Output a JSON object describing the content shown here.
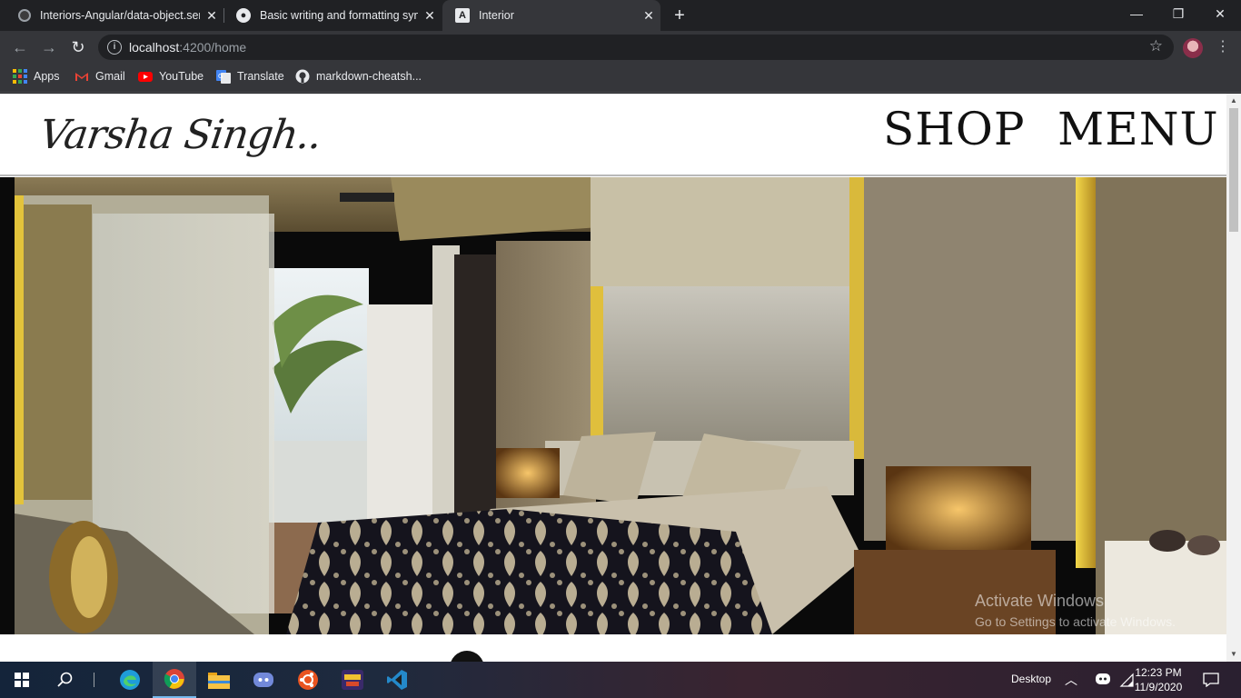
{
  "browser": {
    "tabs": [
      {
        "title": "Interiors-Angular/data-object.ser",
        "icon": "github-icon",
        "active": false
      },
      {
        "title": "Basic writing and formatting synt",
        "icon": "github-icon",
        "active": false
      },
      {
        "title": "Interior",
        "icon": "angular-icon",
        "active": true
      }
    ],
    "address": {
      "host": "localhost",
      "rest": ":4200/home"
    },
    "bookmarks": [
      {
        "label": "Apps",
        "icon": "apps-grid-icon"
      },
      {
        "label": "Gmail",
        "icon": "gmail-icon"
      },
      {
        "label": "YouTube",
        "icon": "youtube-icon"
      },
      {
        "label": "Translate",
        "icon": "translate-icon"
      },
      {
        "label": "markdown-cheatsh...",
        "icon": "github-icon"
      }
    ]
  },
  "site": {
    "logo_text": "Varsha Singh..",
    "nav": {
      "shop": "SHOP",
      "menu": "MENU"
    }
  },
  "watermark": {
    "line1": "Activate Windows",
    "line2": "Go to Settings to activate Windows."
  },
  "taskbar": {
    "desktop_label": "Desktop",
    "time": "12:23 PM",
    "date": "11/9/2020"
  }
}
